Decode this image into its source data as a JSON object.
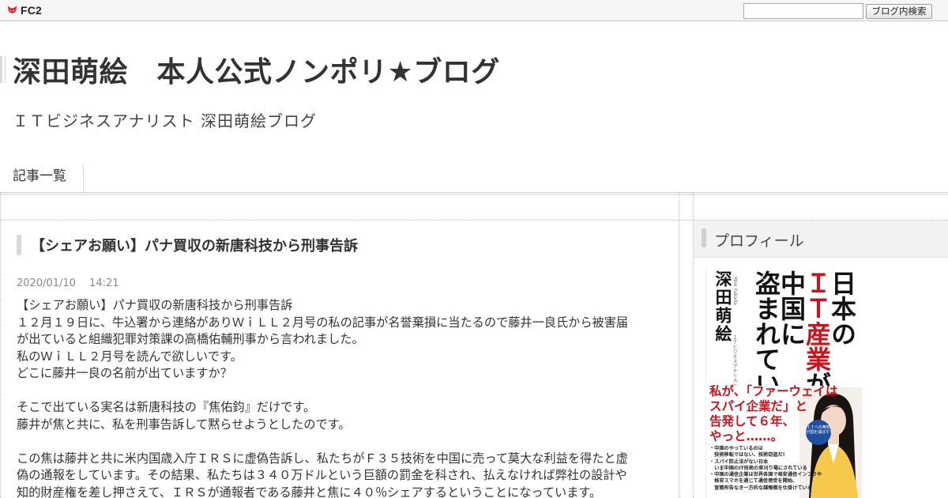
{
  "fc2bar": {
    "logo_text": "FC2",
    "search_placeholder": "",
    "search_button": "ブログ内検索"
  },
  "header": {
    "title": "深田萌絵　本人公式ノンポリ★ブログ",
    "description": "ＩＴビジネスアナリスト 深田萌絵ブログ"
  },
  "nav": {
    "items": [
      {
        "label": "記事一覧"
      }
    ]
  },
  "entry": {
    "title": "【シェアお願い】パナ買収の新唐科技から刑事告訴",
    "date": "2020/01/10　 14:21",
    "body": [
      "【シェアお願い】パナ買収の新唐科技から刑事告訴",
      "１２月１９日に、牛込署から連絡がありＷｉＬＬ２月号の私の記事が名誉棄損に当たるので藤井一良氏から被害届",
      "が出ていると組織犯罪対策課の高橋佑輔刑事から言われました。",
      "私のＷｉＬＬ２月号を読んで欲しいです。",
      "どこに藤井一良の名前が出ていますか？",
      "",
      "そこで出ている実名は新唐科技の『焦佑鈞』だけです。",
      "藤井が焦と共に、私を刑事告訴して黙らせようとしたのです。",
      "",
      "この焦は藤井と共に米内国歳入庁ＩＲＳに虚偽告訴し、私たちがＦ３５技術を中国に売って莫大な利益を得たと虚",
      "偽の通報をしています。その結果、私たちは３４０万ドルという巨額の罰金を科され、払えなければ弊社の設計や",
      "知的財産権を差し押さえて、ＩＲＳが通報者である藤井と焦に４０％シェアするということになっています。"
    ]
  },
  "sidebar": {
    "profile_title": "プロフィール",
    "book": {
      "author": "深田萌絵",
      "author_sub": "Moe Fukada",
      "author_sub2": "ＩＴビジネスアナリスト",
      "title_col1": "日本の",
      "title_col2_red": "ＩＴ産業",
      "title_col2_tail": "が",
      "title_col3": "中国に",
      "title_col4": "盗まれている",
      "slogan": [
        "私が、「ファーウェイは",
        "スパイ企業だ」と",
        "告発して６年、",
        "やっと……。"
      ],
      "badge": "ＩＴへの無知が国を滅ぼす!",
      "bullets": [
        "・中国のやっているのは",
        "　技術移転ではない、技術窃盗だ!",
        "・スパイ防止法がない日本",
        "　いま中国のIT技術の草刈り場にされている",
        "・中国の通信企業は世界各国で格安通信インフラや",
        "　格安スマホを通じて通信傍受を開始、",
        "　宣戦布告なき一方的な諜報戦を仕掛けている"
      ]
    }
  },
  "colors": {
    "accent_red": "#c8141e",
    "text": "#333333",
    "muted": "#888888"
  }
}
